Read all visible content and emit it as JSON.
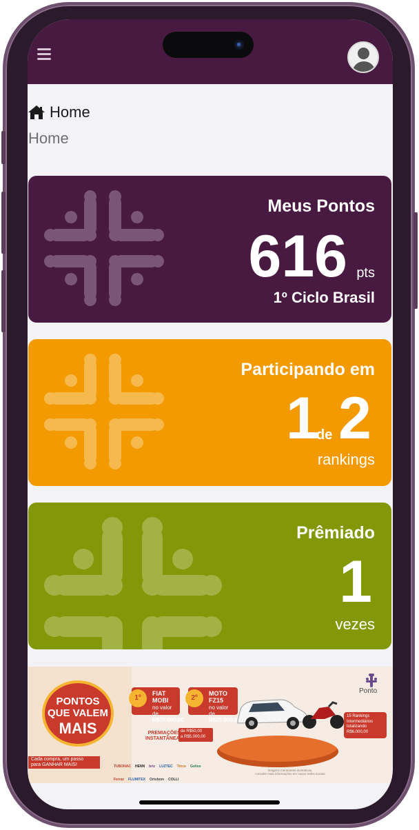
{
  "breadcrumb": {
    "label": "Home"
  },
  "page": {
    "subtitle": "Home"
  },
  "cards": {
    "points": {
      "title": "Meus Pontos",
      "value": "616",
      "unit": "pts",
      "caption": "1º Ciclo Brasil"
    },
    "participating": {
      "title": "Participando em",
      "current": "1",
      "connector": "de",
      "total": "2",
      "caption": "rankings"
    },
    "awarded": {
      "title": "Prêmiado",
      "value": "1",
      "caption": "vezes"
    }
  },
  "banner": {
    "headline_1": "PONTOS",
    "headline_2": "QUE VALEM",
    "headline_3": "MAIS",
    "cta_1": "Cada compra, um passo",
    "cta_2": "para GANHAR MAIS!",
    "prize_1_rank": "1º",
    "prize_1_name": "FIAT MOBI",
    "prize_1_label": "no valor de",
    "prize_1_value": "R$70.000,00",
    "prize_2_rank": "2º",
    "prize_2_name": "MOTO FZ15",
    "prize_2_label": "no valor de",
    "prize_2_value": "R$20.000,00",
    "instant_1": "PREMIAÇÕES",
    "instant_2": "INSTANTÂNEAS",
    "instant_val_1": "de R$50,00",
    "instant_val_2": "a R$5.000,00",
    "rankings_1": "15 Rankings",
    "rankings_2": "Intermediários",
    "rankings_3": "totalizando",
    "rankings_4": "R$6.000,00",
    "logo_text": "Ponto",
    "sponsors": [
      "TUBONAC",
      "HENN",
      "briz",
      "LUZTEC",
      "Tinco",
      "Golius",
      "Ferraz",
      "FLUMITEX",
      "Ortobom",
      "COLLI"
    ],
    "disclaimer_1": "Imagens meramente ilustrativas,",
    "disclaimer_2": "consulte mais informações em nosso redes sociais"
  },
  "colors": {
    "purple": "#481a41",
    "orange": "#f29a00",
    "green": "#839809",
    "page_bg": "#f2f2f7"
  },
  "icons": {
    "menu": "hamburger-menu-icon",
    "profile": "user-avatar-icon",
    "home": "home-icon"
  }
}
